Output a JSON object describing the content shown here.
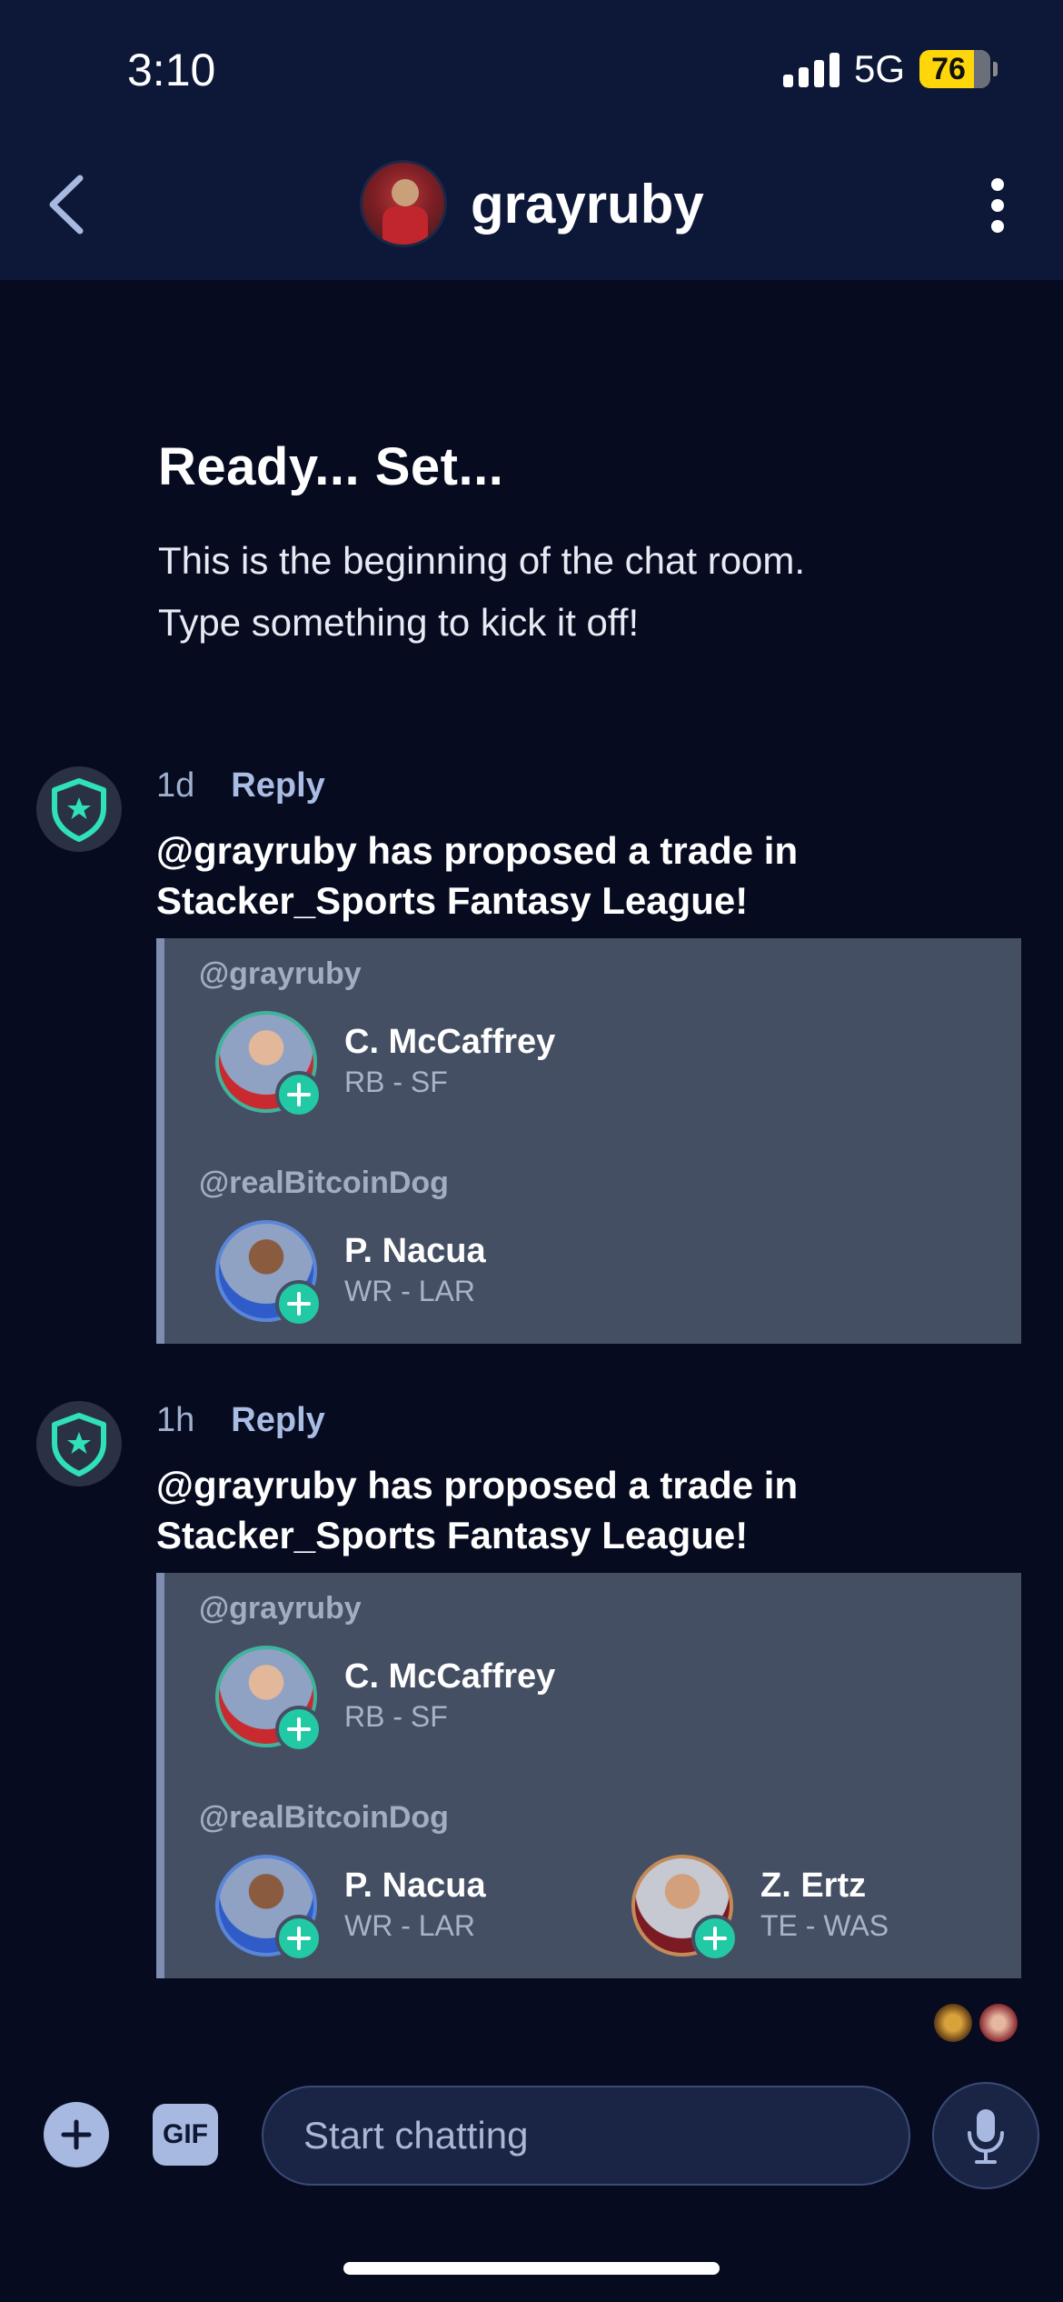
{
  "status_bar": {
    "time": "3:10",
    "network": "5G",
    "battery": "76"
  },
  "header": {
    "title": "grayruby"
  },
  "intro": {
    "title": "Ready... Set...",
    "line1": "This is the beginning of the chat room.",
    "line2": "Type something to kick it off!"
  },
  "messages": [
    {
      "time": "1d",
      "reply_label": "Reply",
      "text": "@grayruby has proposed a trade in Stacker_Sports Fantasy League!",
      "trade": {
        "from_user": "@grayruby",
        "from_players": [
          {
            "name": "C. McCaffrey",
            "position": "RB - SF"
          }
        ],
        "to_user": "@realBitcoinDog",
        "to_players": [
          {
            "name": "P. Nacua",
            "position": "WR - LAR"
          }
        ]
      }
    },
    {
      "time": "1h",
      "reply_label": "Reply",
      "text": "@grayruby has proposed a trade in Stacker_Sports Fantasy League!",
      "trade": {
        "from_user": "@grayruby",
        "from_players": [
          {
            "name": "C. McCaffrey",
            "position": "RB - SF"
          }
        ],
        "to_user": "@realBitcoinDog",
        "to_players": [
          {
            "name": "P. Nacua",
            "position": "WR - LAR"
          },
          {
            "name": "Z. Ertz",
            "position": "TE - WAS"
          }
        ]
      }
    }
  ],
  "composer": {
    "gif_label": "GIF",
    "placeholder": "Start chatting"
  },
  "colors": {
    "background": "#070b1f",
    "header": "#0d1838",
    "card": "#454f63",
    "accent": "#22c9a5",
    "battery": "#ffd60a"
  },
  "icons": [
    "back-chevron-icon",
    "more-vertical-icon",
    "shield-star-icon",
    "plus-icon",
    "gif-icon",
    "microphone-icon"
  ]
}
